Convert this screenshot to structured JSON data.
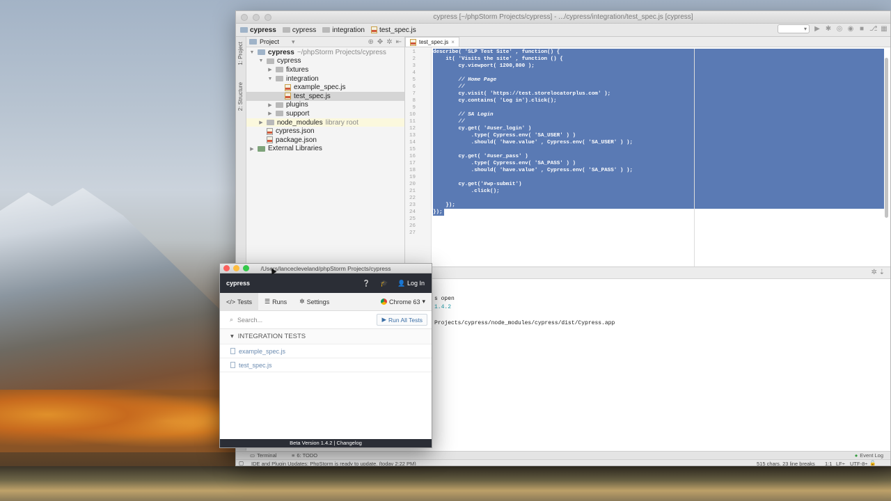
{
  "ide": {
    "window_title": "cypress [~/phpStorm Projects/cypress] - .../cypress/integration/test_spec.js [cypress]",
    "breadcrumbs": [
      "cypress",
      "cypress",
      "integration",
      "test_spec.js"
    ],
    "side_tabs": [
      "1: Project",
      "2: Structure"
    ],
    "project_panel": {
      "title": "Project",
      "tree": [
        {
          "label": "cypress",
          "suffix": "~/phpStorm Projects/cypress",
          "depth": 0,
          "expanded": true,
          "type": "folder"
        },
        {
          "label": "cypress",
          "suffix": "",
          "depth": 1,
          "expanded": true,
          "type": "folder"
        },
        {
          "label": "fixtures",
          "suffix": "",
          "depth": 2,
          "expanded": false,
          "type": "folder"
        },
        {
          "label": "integration",
          "suffix": "",
          "depth": 2,
          "expanded": true,
          "type": "folder"
        },
        {
          "label": "example_spec.js",
          "suffix": "",
          "depth": 3,
          "type": "js"
        },
        {
          "label": "test_spec.js",
          "suffix": "",
          "depth": 3,
          "type": "js"
        },
        {
          "label": "plugins",
          "suffix": "",
          "depth": 2,
          "expanded": false,
          "type": "folder"
        },
        {
          "label": "support",
          "suffix": "",
          "depth": 2,
          "expanded": false,
          "type": "folder"
        },
        {
          "label": "node_modules",
          "suffix": "library root",
          "depth": 1,
          "expanded": false,
          "type": "folder"
        },
        {
          "label": "cypress.json",
          "suffix": "",
          "depth": 1,
          "type": "json"
        },
        {
          "label": "package.json",
          "suffix": "",
          "depth": 1,
          "type": "json"
        },
        {
          "label": "External Libraries",
          "suffix": "",
          "depth": 0,
          "expanded": false,
          "type": "lib"
        }
      ]
    },
    "editor": {
      "tab": "test_spec.js",
      "line_numbers": [
        "1",
        "2",
        "3",
        "4",
        "5",
        "6",
        "7",
        "8",
        "9",
        "10",
        "11",
        "12",
        "13",
        "14",
        "15",
        "16",
        "17",
        "18",
        "19",
        "20",
        "21",
        "22",
        "23",
        "24",
        "25",
        "26",
        "27"
      ],
      "lines": [
        "describe( 'SLP Test Site' , function() {",
        "    it( 'Visits the site' , function () {",
        "        cy.viewport( 1200,800 );",
        "",
        "        // Home Page",
        "        //",
        "        cy.visit( 'https://test.storelocatorplus.com' );",
        "        cy.contains( 'Log in').click();",
        "",
        "        // SA Login",
        "        //",
        "        cy.get( '#user_login' )",
        "            .type( Cypress.env( 'SA_USER' ) )",
        "            .should( 'have.value' , Cypress.env( 'SA_USER' ) );",
        "",
        "        cy.get( '#user_pass' )",
        "            .type( Cypress.env( 'SA_PASS' ) )",
        "            .should( 'have.value' , Cypress.env( 'SA_PASS' ) );",
        "",
        "        cy.get('#wp-submit')",
        "            .click();",
        "",
        "    });",
        "});",
        "",
        "",
        ""
      ]
    },
    "terminal": {
      "lines": [
        "s open",
        "1.4.2",
        "",
        "Projects/cypress/node_modules/cypress/dist/Cypress.app"
      ]
    },
    "bottom_tabs": {
      "terminal": "Terminal",
      "todo": "6: TODO",
      "event_log": "Event Log"
    },
    "status": {
      "message": "IDE and Plugin Updates: PhpStorm is ready to update. (today 2:22 PM)",
      "chars": "515 chars, 23 line breaks",
      "position": "1:1",
      "line_sep": "LF÷",
      "encoding": "UTF-8÷"
    },
    "colors": {
      "selection": "#5a7ab4",
      "cypress_dark": "#2b2e36",
      "link_blue": "#3a6ea5"
    }
  },
  "cypress_app": {
    "window_title": "/Users/lancecleveland/phpStorm Projects/cypress",
    "brand": "cypress",
    "login_label": "Log In",
    "tabs": [
      "Tests",
      "Runs",
      "Settings"
    ],
    "browser": "Chrome 63",
    "search_placeholder": "Search...",
    "run_all_label": "Run All Tests",
    "section_title": "INTEGRATION TESTS",
    "files": [
      "example_spec.js",
      "test_spec.js"
    ],
    "footer": "Beta Version 1.4.2 | Changelog"
  }
}
